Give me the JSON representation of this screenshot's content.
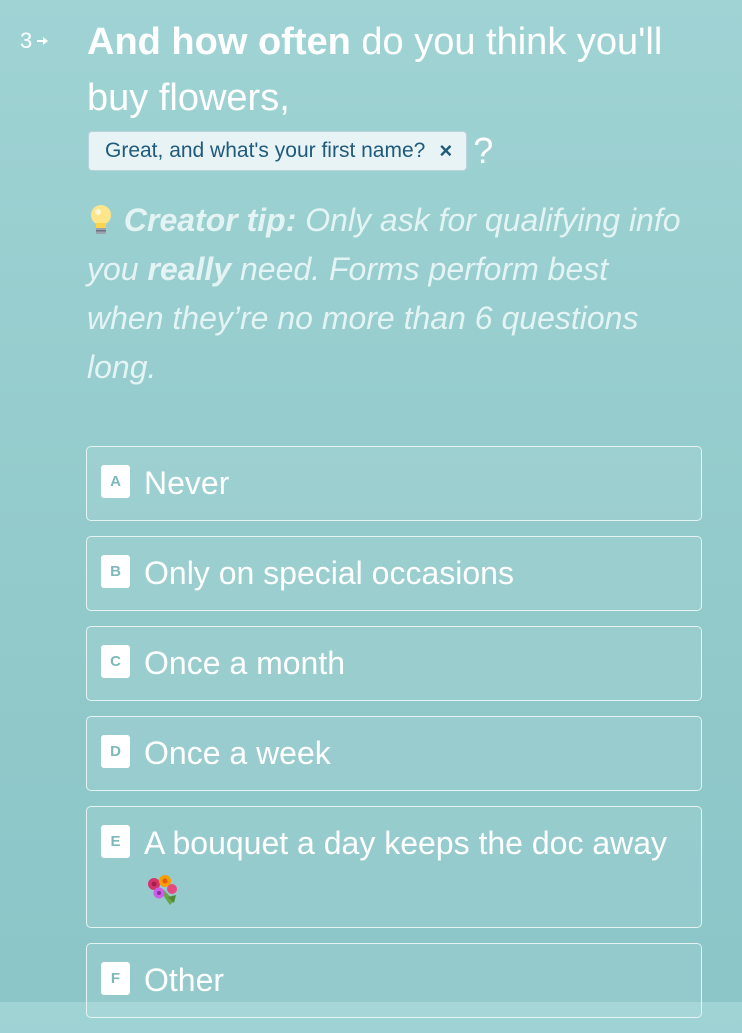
{
  "question": {
    "number": "3",
    "bold_text": "And how often",
    "rest_text": " do you think you'll buy flowers,",
    "recall_chip": {
      "label": "Great, and what's your first name?",
      "remove_symbol": "×"
    },
    "trailing": "?"
  },
  "tip": {
    "label": "Creator tip:",
    "text_before": " Only ask for qualifying info you ",
    "emphasis": "really",
    "text_after": " need. Forms perform best when they’re no more than 6 questions long."
  },
  "options": [
    {
      "key": "A",
      "label": "Never"
    },
    {
      "key": "B",
      "label": "Only on special occasions"
    },
    {
      "key": "C",
      "label": "Once a month"
    },
    {
      "key": "D",
      "label": "Once a week"
    },
    {
      "key": "E",
      "label": "A bouquet a day keeps the doc away"
    },
    {
      "key": "F",
      "label": "Other"
    }
  ],
  "icons": {
    "arrow": "arrow-right-icon",
    "bulb": "lightbulb-icon",
    "bouquet": "bouquet-icon"
  }
}
